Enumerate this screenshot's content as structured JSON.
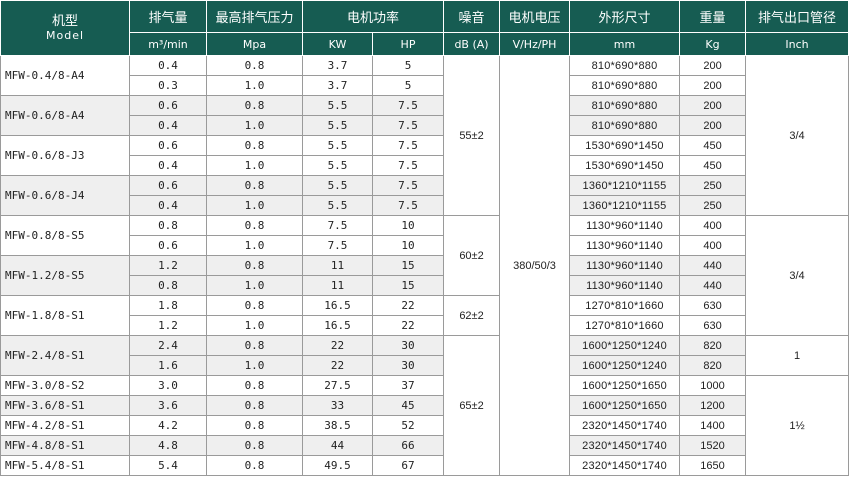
{
  "header": {
    "model_zh": "机型",
    "model_en": "Model",
    "displacement": "排气量",
    "max_pressure": "最高排气压力",
    "motor_power": "电机功率",
    "noise": "噪音",
    "motor_voltage": "电机电压",
    "dimensions": "外形尺寸",
    "weight": "重量",
    "outlet_pipe": "排气出口管径"
  },
  "units": {
    "displacement": "m³/min",
    "pressure": "Mpa",
    "kw": "KW",
    "hp": "HP",
    "noise": "dB (A)",
    "voltage": "V/Hz/PH",
    "dimensions": "mm",
    "weight": "Kg",
    "outlet": "Inch"
  },
  "models": [
    {
      "name": "MFW-0.4/8-A4"
    },
    {
      "name": "MFW-0.6/8-A4"
    },
    {
      "name": "MFW-0.6/8-J3"
    },
    {
      "name": "MFW-0.6/8-J4"
    },
    {
      "name": "MFW-0.8/8-S5"
    },
    {
      "name": "MFW-1.2/8-S5"
    },
    {
      "name": "MFW-1.8/8-S1"
    },
    {
      "name": "MFW-2.4/8-S1"
    },
    {
      "name": "MFW-3.0/8-S2"
    },
    {
      "name": "MFW-3.6/8-S1"
    },
    {
      "name": "MFW-4.2/8-S1"
    },
    {
      "name": "MFW-4.8/8-S1"
    },
    {
      "name": "MFW-5.4/8-S1"
    }
  ],
  "rows": [
    {
      "disp": "0.4",
      "mpa": "0.8",
      "kw": "3.7",
      "hp": "5",
      "dim": "810*690*880",
      "kg": "200"
    },
    {
      "disp": "0.3",
      "mpa": "1.0",
      "kw": "3.7",
      "hp": "5",
      "dim": "810*690*880",
      "kg": "200"
    },
    {
      "disp": "0.6",
      "mpa": "0.8",
      "kw": "5.5",
      "hp": "7.5",
      "dim": "810*690*880",
      "kg": "200"
    },
    {
      "disp": "0.4",
      "mpa": "1.0",
      "kw": "5.5",
      "hp": "7.5",
      "dim": "810*690*880",
      "kg": "200"
    },
    {
      "disp": "0.6",
      "mpa": "0.8",
      "kw": "5.5",
      "hp": "7.5",
      "dim": "1530*690*1450",
      "kg": "450"
    },
    {
      "disp": "0.4",
      "mpa": "1.0",
      "kw": "5.5",
      "hp": "7.5",
      "dim": "1530*690*1450",
      "kg": "450"
    },
    {
      "disp": "0.6",
      "mpa": "0.8",
      "kw": "5.5",
      "hp": "7.5",
      "dim": "1360*1210*1155",
      "kg": "250"
    },
    {
      "disp": "0.4",
      "mpa": "1.0",
      "kw": "5.5",
      "hp": "7.5",
      "dim": "1360*1210*1155",
      "kg": "250"
    },
    {
      "disp": "0.8",
      "mpa": "0.8",
      "kw": "7.5",
      "hp": "10",
      "dim": "1130*960*1140",
      "kg": "400"
    },
    {
      "disp": "0.6",
      "mpa": "1.0",
      "kw": "7.5",
      "hp": "10",
      "dim": "1130*960*1140",
      "kg": "400"
    },
    {
      "disp": "1.2",
      "mpa": "0.8",
      "kw": "11",
      "hp": "15",
      "dim": "1130*960*1140",
      "kg": "440"
    },
    {
      "disp": "0.8",
      "mpa": "1.0",
      "kw": "11",
      "hp": "15",
      "dim": "1130*960*1140",
      "kg": "440"
    },
    {
      "disp": "1.8",
      "mpa": "0.8",
      "kw": "16.5",
      "hp": "22",
      "dim": "1270*810*1660",
      "kg": "630"
    },
    {
      "disp": "1.2",
      "mpa": "1.0",
      "kw": "16.5",
      "hp": "22",
      "dim": "1270*810*1660",
      "kg": "630"
    },
    {
      "disp": "2.4",
      "mpa": "0.8",
      "kw": "22",
      "hp": "30",
      "dim": "1600*1250*1240",
      "kg": "820"
    },
    {
      "disp": "1.6",
      "mpa": "1.0",
      "kw": "22",
      "hp": "30",
      "dim": "1600*1250*1240",
      "kg": "820"
    },
    {
      "disp": "3.0",
      "mpa": "0.8",
      "kw": "27.5",
      "hp": "37",
      "dim": "1600*1250*1650",
      "kg": "1000"
    },
    {
      "disp": "3.6",
      "mpa": "0.8",
      "kw": "33",
      "hp": "45",
      "dim": "1600*1250*1650",
      "kg": "1200"
    },
    {
      "disp": "4.2",
      "mpa": "0.8",
      "kw": "38.5",
      "hp": "52",
      "dim": "2320*1450*1740",
      "kg": "1400"
    },
    {
      "disp": "4.8",
      "mpa": "0.8",
      "kw": "44",
      "hp": "66",
      "dim": "2320*1450*1740",
      "kg": "1520"
    },
    {
      "disp": "5.4",
      "mpa": "0.8",
      "kw": "49.5",
      "hp": "67",
      "dim": "2320*1450*1740",
      "kg": "1650"
    }
  ],
  "merged": {
    "noise": [
      "55±2",
      "60±2",
      "62±2",
      "65±2"
    ],
    "voltage": "380/50/3",
    "outlet": [
      "3/4",
      "3/4",
      "1",
      "1½"
    ]
  },
  "colors": {
    "header_bg": "#165c52",
    "header_text": "#ffffff",
    "alt_row_bg": "#efefef",
    "border": "#9a9a9a"
  }
}
